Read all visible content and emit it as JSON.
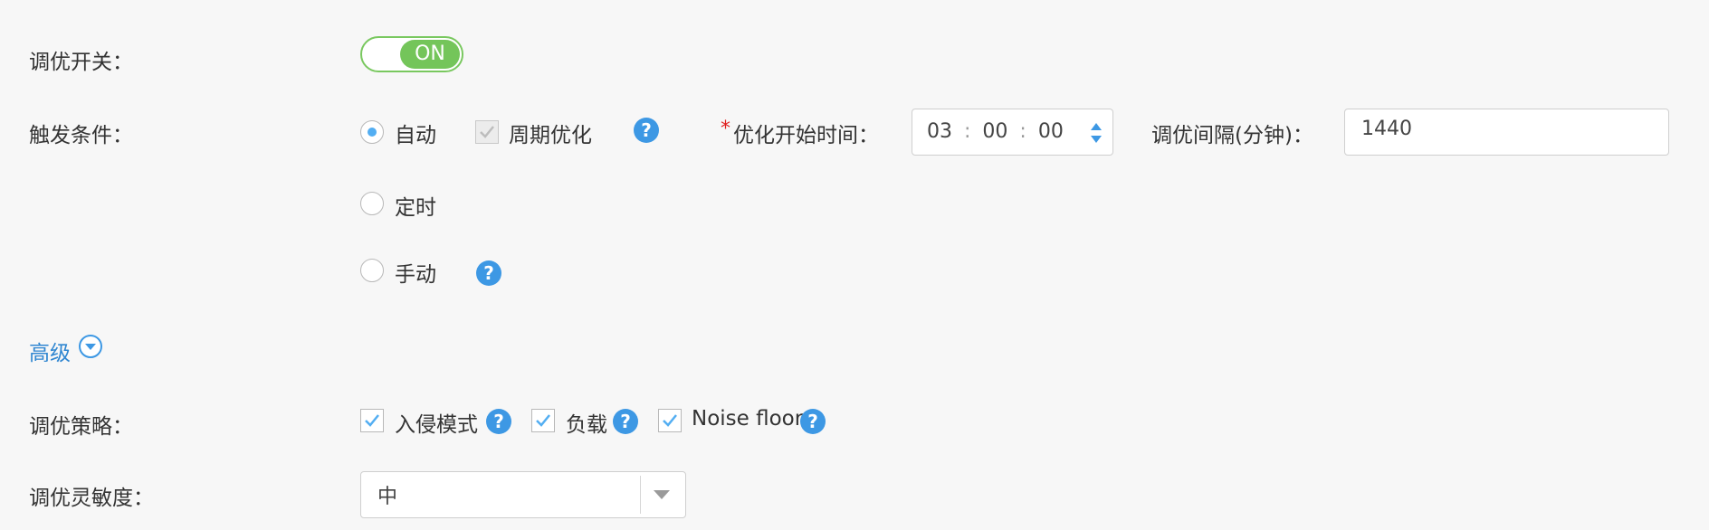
{
  "tuning_switch": {
    "label": "调优开关：",
    "state": "ON"
  },
  "trigger": {
    "label": "触发条件：",
    "options": [
      {
        "label": "自动",
        "selected": true
      },
      {
        "label": "定时",
        "selected": false
      },
      {
        "label": "手动",
        "selected": false
      }
    ],
    "periodic_label": "周期优化",
    "periodic_checked": true,
    "start_time_required": "*",
    "start_time_label": "优化开始时间：",
    "start_time": {
      "hh": "03",
      "mm": "00",
      "ss": "00",
      "sep": ":"
    },
    "interval_label": "调优间隔(分钟)：",
    "interval_value": "1440"
  },
  "advanced": {
    "label": "高级"
  },
  "strategy": {
    "label": "调优策略：",
    "items": [
      {
        "label": "入侵模式",
        "checked": true
      },
      {
        "label": "负载",
        "checked": true
      },
      {
        "label": "Noise floor",
        "checked": true
      }
    ]
  },
  "sensitivity": {
    "label": "调优灵敏度：",
    "value": "中"
  },
  "colors": {
    "accent": "#74c55a",
    "link": "#2f86d1",
    "help": "#3d98e4",
    "radio": "#53aef2"
  },
  "icons": {
    "help": "?"
  }
}
